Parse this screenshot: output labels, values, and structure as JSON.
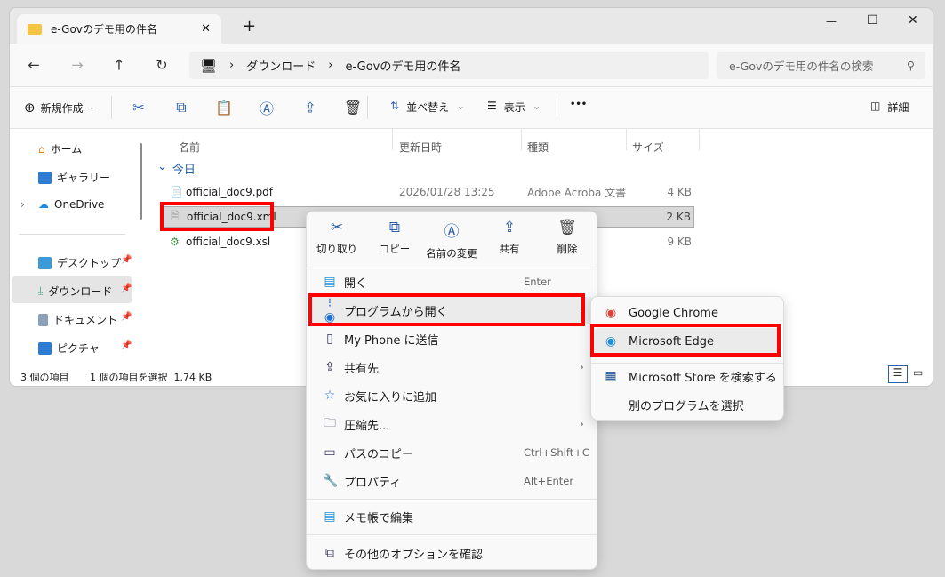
{
  "tab": {
    "title": "e-Govのデモ用の件名",
    "close": "✕",
    "new": "+"
  },
  "window_controls": {
    "minimize": "—",
    "maximize": "☐",
    "close": "✕"
  },
  "address": {
    "sep": "›",
    "crumbs": [
      "ダウンロード",
      "e-Govのデモ用の件名"
    ],
    "search_placeholder": "e-Govのデモ用の件名の検索"
  },
  "toolbar": {
    "new": "新規作成",
    "sort": "並べ替え",
    "view": "表示",
    "more": "•••",
    "details": "詳細"
  },
  "sidebar": [
    "ホーム",
    "ギャラリー",
    "OneDrive",
    "デスクトップ",
    "ダウンロード",
    "ドキュメント",
    "ピクチャ"
  ],
  "columns": [
    "名前",
    "更新日時",
    "種類",
    "サイズ"
  ],
  "group": "今日",
  "files": [
    {
      "name": "official_doc9.pdf",
      "date": "2026/01/28 13:25",
      "type": "Adobe Acroba 文書",
      "size": "4 KB"
    },
    {
      "name": "official_doc9.xml",
      "date": "",
      "type": "",
      "size": "2 KB"
    },
    {
      "name": "official_doc9.xsl",
      "date": "",
      "type": "",
      "size": "9 KB"
    }
  ],
  "status": {
    "count": "3 個の項目",
    "selected": "1 個の項目を選択  1.74 KB"
  },
  "context_menu": {
    "top": [
      "切り取り",
      "コピー",
      "名前の変更",
      "共有",
      "削除"
    ],
    "items": [
      {
        "label": "開く",
        "shortcut": "Enter"
      },
      {
        "label": "プログラムから開く"
      },
      {
        "label": "My Phone に送信"
      },
      {
        "label": "共有先"
      },
      {
        "label": "お気に入りに追加"
      },
      {
        "label": "圧縮先..."
      },
      {
        "label": "パスのコピー",
        "shortcut": "Ctrl+Shift+C"
      },
      {
        "label": "プロパティ",
        "shortcut": "Alt+Enter"
      },
      {
        "label": "メモ帳で編集"
      },
      {
        "label": "その他のオプションを確認"
      }
    ]
  },
  "submenu": [
    "Google Chrome",
    "Microsoft Edge",
    "Microsoft Store を検索する",
    "別のプログラムを選択"
  ],
  "colors": {
    "highlight": "#ff0000",
    "selected_row": "#d9d9d9"
  }
}
